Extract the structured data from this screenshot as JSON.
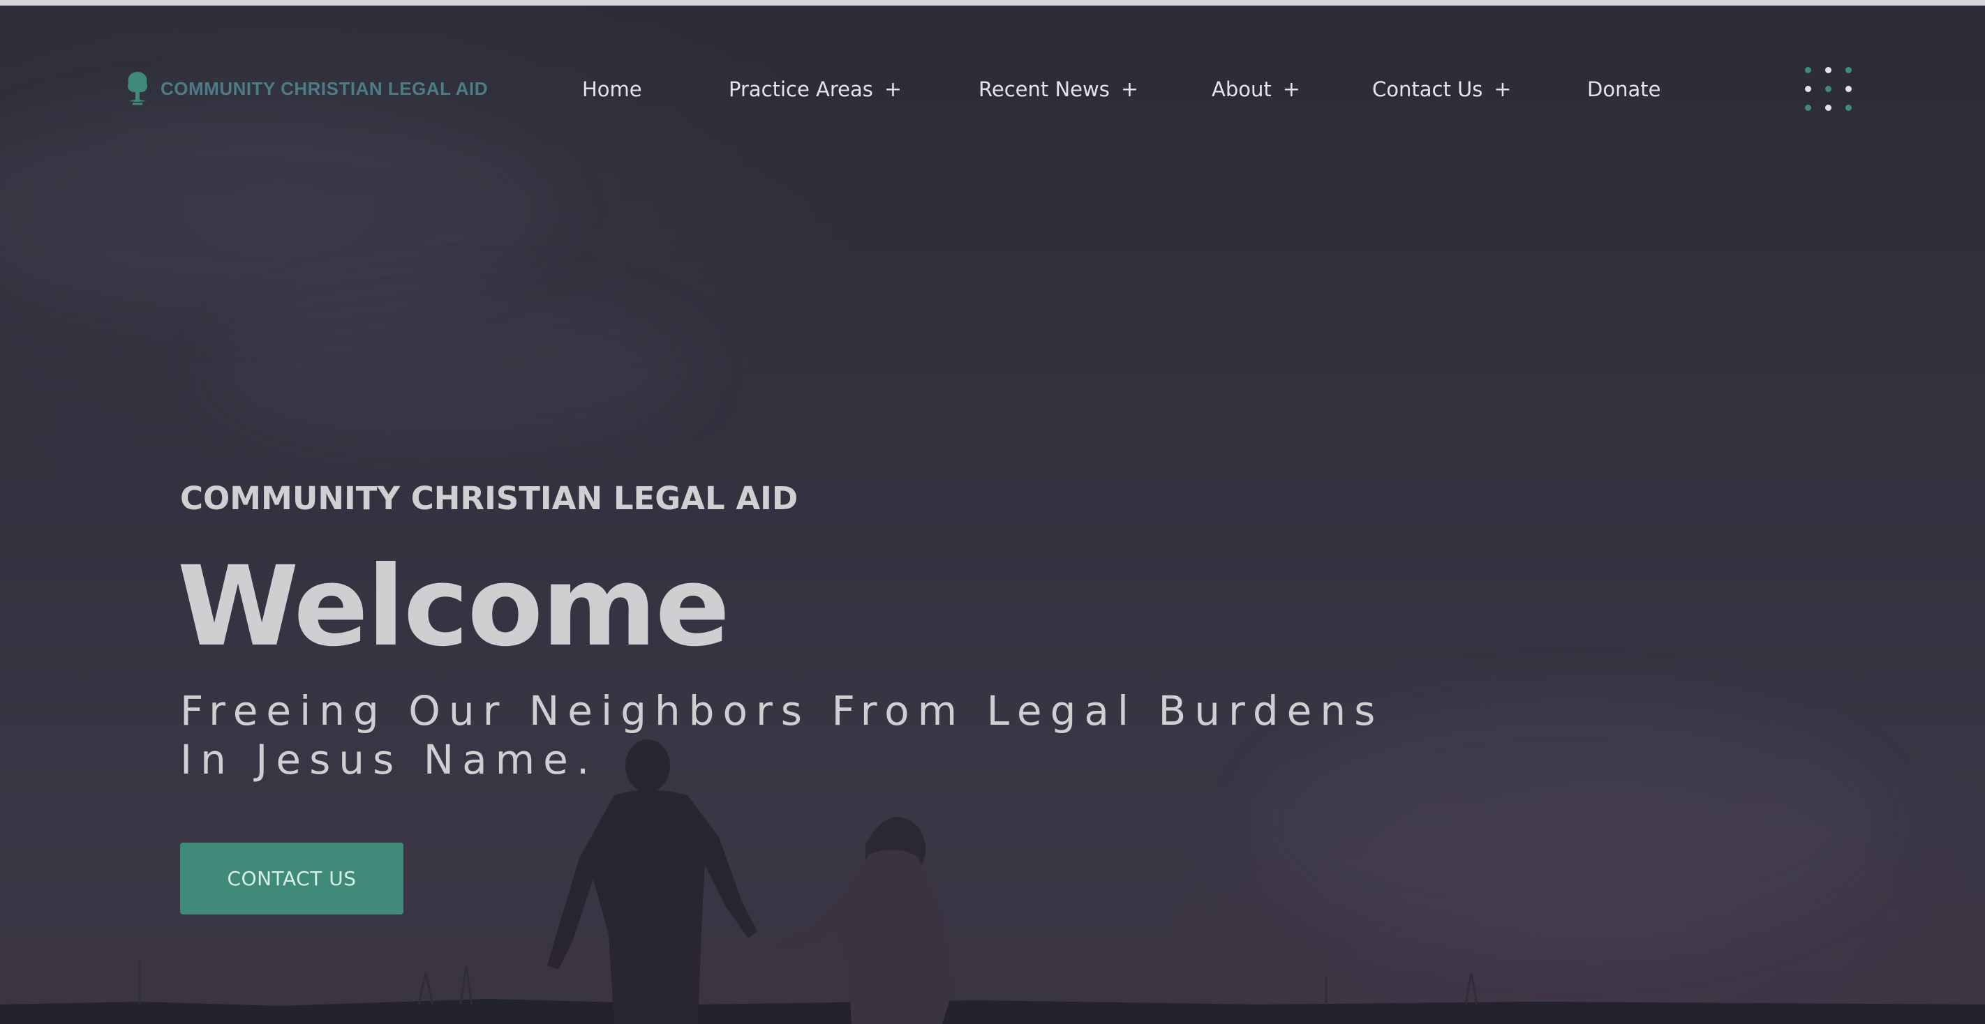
{
  "header": {
    "logo_text": "COMMUNITY CHRISTIAN LEGAL AID",
    "nav": [
      {
        "label": "Home",
        "has_submenu": false
      },
      {
        "label": "Practice Areas",
        "has_submenu": true
      },
      {
        "label": "Recent News",
        "has_submenu": true
      },
      {
        "label": "About",
        "has_submenu": true
      },
      {
        "label": "Contact Us",
        "has_submenu": true
      },
      {
        "label": "Donate",
        "has_submenu": false
      }
    ],
    "submenu_indicator": "+",
    "menu_icon": "dots-grid-icon"
  },
  "hero": {
    "eyebrow": "COMMUNITY CHRISTIAN LEGAL AID",
    "headline": "Welcome",
    "tagline_line1": "Freeing Our Neighbors From Legal Burdens",
    "tagline_line2": "In Jesus Name.",
    "cta_label": "CONTACT US"
  },
  "colors": {
    "accent": "#3f8a79",
    "logo_text": "#4e7c86",
    "nav_text": "#e4e4e8",
    "overlay_dark": "#2b2c37"
  }
}
